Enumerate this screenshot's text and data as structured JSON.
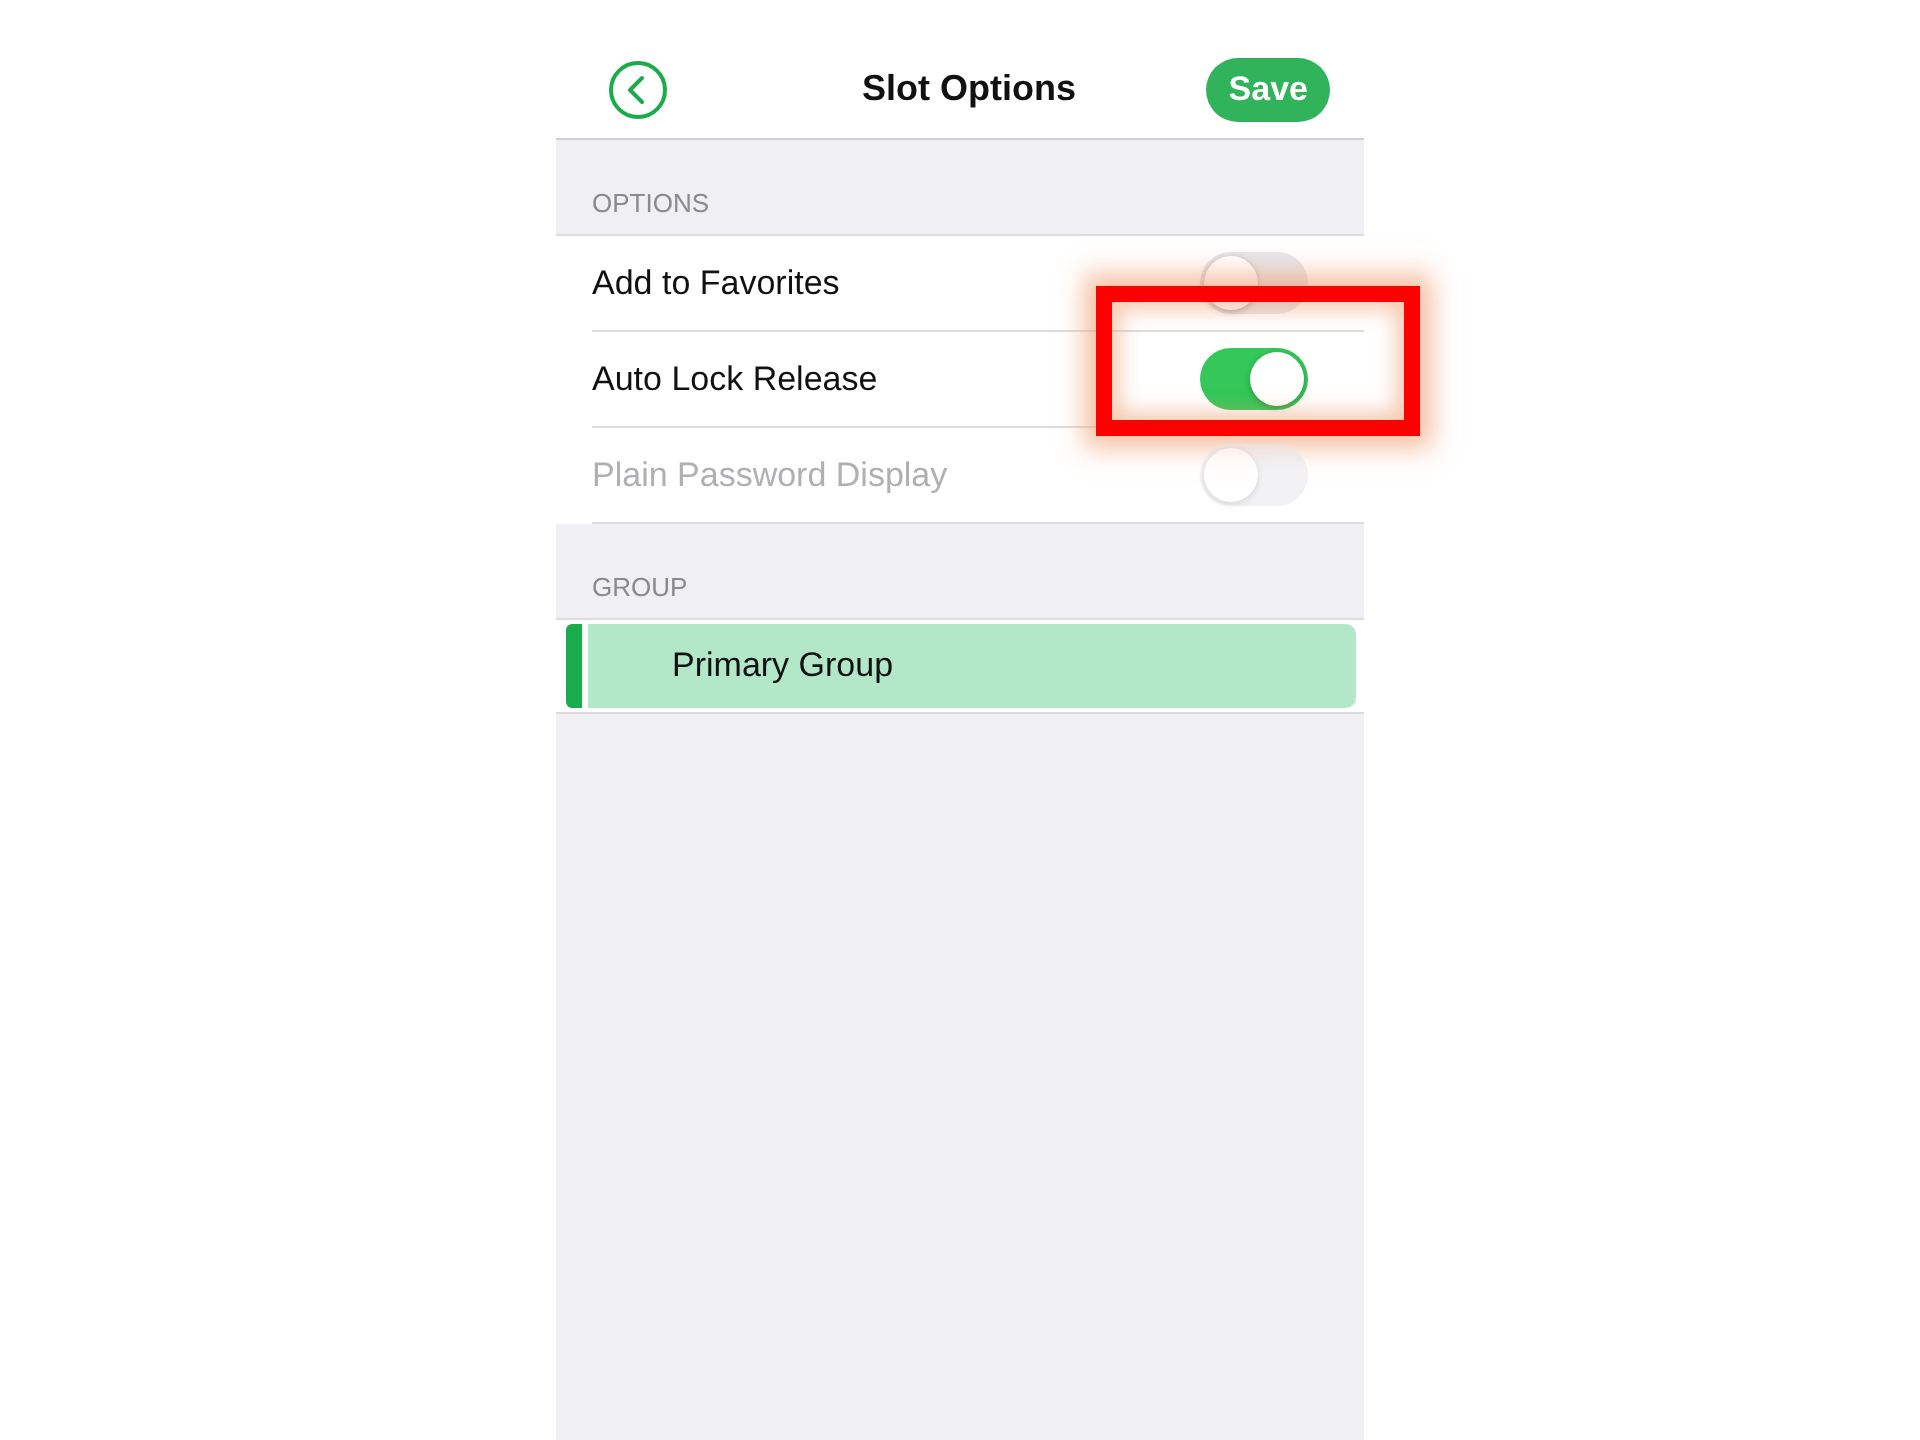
{
  "header": {
    "title": "Slot Options",
    "save": "Save"
  },
  "sections": [
    {
      "heading": "OPTIONS",
      "kind": "toggles",
      "items": [
        {
          "label": "Add to Favorites",
          "checked": false,
          "disabled": false,
          "highlighted": false
        },
        {
          "label": "Auto Lock Release",
          "checked": true,
          "disabled": false,
          "highlighted": true
        },
        {
          "label": "Plain Password Display",
          "checked": false,
          "disabled": true,
          "highlighted": false
        }
      ]
    },
    {
      "heading": "GROUP",
      "kind": "choices",
      "items": [
        {
          "label": "Primary Group",
          "selected": true
        }
      ]
    }
  ]
}
